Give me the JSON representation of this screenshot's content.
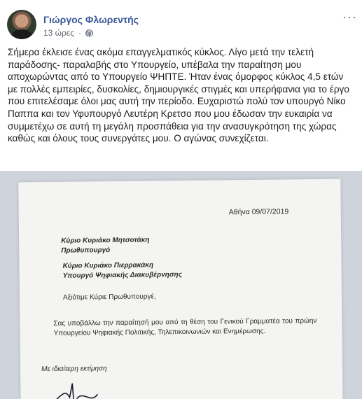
{
  "post": {
    "author": "Γιώργος Φλωρεντής",
    "time": "13 ώρες",
    "more_icon": "···",
    "text": "Σήμερα έκλεισε ένας ακόμα επαγγελματικός κύκλος. Λίγο μετά την τελετή παράδοσης- παραλαβής στο Υπουργείο, υπέβαλα την παραίτηση μου αποχωρώντας από το Υπουργείο ΨΗΠΤΕ. Ήταν ένας όμορφος κύκλος 4,5 ετών με πολλές εμπειρίες, δυσκολίες, δημιουργικές στιγμές και υπερήφανια για το έργο που επιτελέσαμε όλοι μας αυτή την περίοδο. Ευχαριστώ πολύ τον υπουργό Νίκο Παππα και τον Υφυπουργό Λευτέρη Κρετσο που μου έδωσαν την ευκαιρία να συμμετέχω σε αυτή τη μεγάλη προσπάθεια για την ανασυγκρότηση της χώρας καθώς και όλους τους συνεργάτες μου. Ο αγώνας συνεχίζεται."
  },
  "letter": {
    "date": "Αθήνα 09/07/2019",
    "recipient1_line1": "Κύριο Κυριάκο Μητσοτάκη",
    "recipient1_line2": "Πρωθυπουργό",
    "recipient2_line1": "Κύριο Κυριάκο Πιερρακάκη",
    "recipient2_line2": "Υπουργό Ψηφιακής Διακυβέρνησης",
    "greeting": "Αξιότιμε Κύριε Πρωθυπουργέ,",
    "body": "Σας υποβάλλω την παραίτησή μου από τη θέση του Γενικού Γραμματέα του πρώην Υπουργείου Ψηφιακής Πολιτικής, Τηλεπικοινωνιών και Ενημέρωσης.",
    "closing": "Με ιδιαίτερη εκτίμηση"
  },
  "icons": {
    "avatar": "avatar",
    "privacy": "globe-icon",
    "more": "more-options-icon"
  }
}
